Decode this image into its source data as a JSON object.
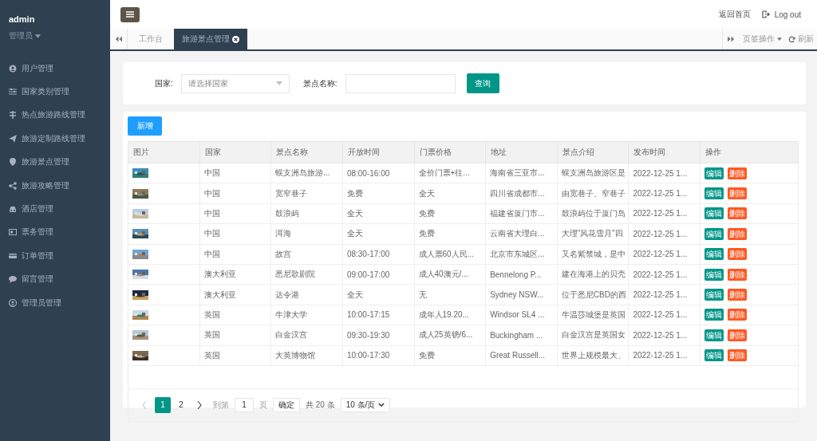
{
  "user": {
    "name": "admin",
    "role": "管理员"
  },
  "sidebar": {
    "items": [
      {
        "label": "用户管理"
      },
      {
        "label": "国家类别管理"
      },
      {
        "label": "热点旅游路线管理"
      },
      {
        "label": "旅游定制路线管理"
      },
      {
        "label": "旅游景点管理"
      },
      {
        "label": "旅游攻略管理"
      },
      {
        "label": "酒店管理"
      },
      {
        "label": "票务管理"
      },
      {
        "label": "订单管理"
      },
      {
        "label": "留言管理"
      },
      {
        "label": "管理员管理"
      }
    ]
  },
  "header": {
    "links": [
      "返回首页",
      "Log out"
    ]
  },
  "tabs": [
    {
      "label": "工作台",
      "selected": false,
      "closable": false
    },
    {
      "label": "旅游景点管理",
      "selected": true,
      "closable": true
    }
  ],
  "tab_tools": {
    "menu": "页签操作",
    "refresh": "刷新"
  },
  "search": {
    "country_label": "国家:",
    "country_placeholder": "请选择国家",
    "name_label": "景点名称:",
    "button": "查询"
  },
  "add_button": "新增",
  "table": {
    "columns": [
      "图片",
      "国家",
      "景点名称",
      "开放时间",
      "门票价格",
      "地址",
      "景点介绍",
      "发布时间",
      "操作"
    ],
    "rows": [
      {
        "country": "中国",
        "name": "蜈支洲岛旅游...",
        "hours": "08:00-16:00",
        "price": "全价门票+往...",
        "address": "海南省三亚市...",
        "intro": "蜈支洲岛旅游区是",
        "published": "2022-12-25 1...",
        "actions": [
          "编辑",
          "删除"
        ]
      },
      {
        "country": "中国",
        "name": "宽窄巷子",
        "hours": "免费",
        "price": "全天",
        "address": "四川省成都市...",
        "intro": "由宽巷子、窄巷子",
        "published": "2022-12-25 1...",
        "actions": [
          "编辑",
          "删除"
        ]
      },
      {
        "country": "中国",
        "name": "鼓浪屿",
        "hours": "全天",
        "price": "免费",
        "address": "福建省厦门市...",
        "intro": "鼓浪屿位于厦门岛",
        "published": "2022-12-25 1...",
        "actions": [
          "编辑",
          "删除"
        ]
      },
      {
        "country": "中国",
        "name": "洱海",
        "hours": "全天",
        "price": "免费",
        "address": "云南省大理白...",
        "intro": "大理\"风花雪月\"四",
        "published": "2022-12-25 1...",
        "actions": [
          "编辑",
          "删除"
        ]
      },
      {
        "country": "中国",
        "name": "故宫",
        "hours": "08:30-17:00",
        "price": "成人票60人民...",
        "address": "北京市东城区...",
        "intro": "又名紫禁城，是中",
        "published": "2022-12-25 1...",
        "actions": [
          "编辑",
          "删除"
        ]
      },
      {
        "country": "澳大利亚",
        "name": "悉尼歌剧院",
        "hours": "09:00-17:00",
        "price": "成人40澳元/...",
        "address": "Bennelong P...",
        "intro": "建在海港上的贝壳",
        "published": "2022-12-25 1...",
        "actions": [
          "编辑",
          "删除"
        ]
      },
      {
        "country": "澳大利亚",
        "name": "达令港",
        "hours": "全天",
        "price": "无",
        "address": "Sydney NSW...",
        "intro": "位于悉尼CBD的西",
        "published": "2022-12-25 1...",
        "actions": [
          "编辑",
          "删除"
        ]
      },
      {
        "country": "英国",
        "name": "牛津大学",
        "hours": "10:00-17:15",
        "price": "成年人19.20...",
        "address": "Windsor SL4 ...",
        "intro": "牛温莎城堡是英国",
        "published": "2022-12-25 1...",
        "actions": [
          "编辑",
          "删除"
        ]
      },
      {
        "country": "英国",
        "name": "白金汉宫",
        "hours": "09:30-19:30",
        "price": "成人25英镑/6...",
        "address": "Buckingham ...",
        "intro": "白金汉宫是英国女",
        "published": "2022-12-25 1...",
        "actions": [
          "编辑",
          "删除"
        ]
      },
      {
        "country": "英国",
        "name": "大英博物馆",
        "hours": "10:00-17:30",
        "price": "免费",
        "address": "Great Russell...",
        "intro": "世界上规模最大、",
        "published": "2022-12-25 1...",
        "actions": [
          "编辑",
          "删除"
        ]
      }
    ]
  },
  "pagination": {
    "pages": [
      {
        "label": "1",
        "selected": true
      },
      {
        "label": "2",
        "selected": false
      }
    ],
    "goto_label": "到第",
    "goto_value": "1",
    "page_suffix": "页",
    "confirm": "确定",
    "total": "共 20 条",
    "page_size": "10 条/页",
    "prev_disabled": true
  }
}
